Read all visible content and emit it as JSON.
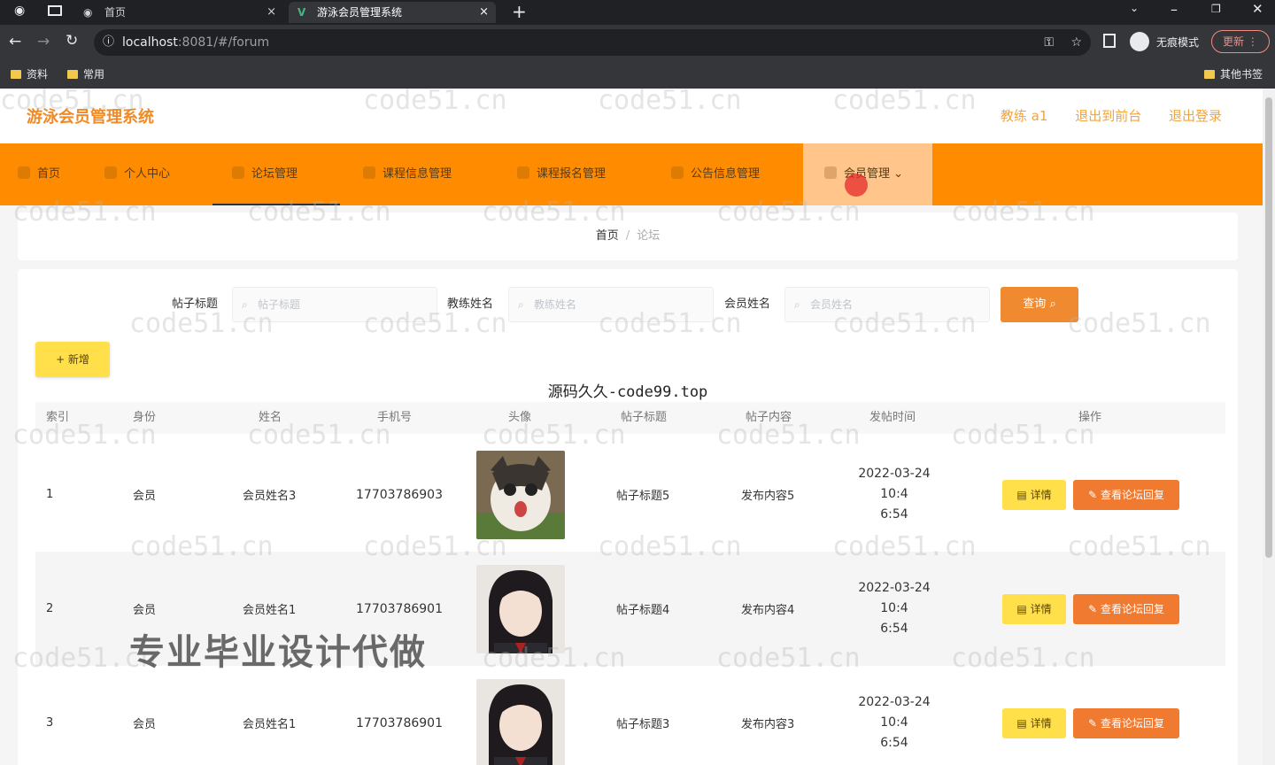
{
  "browser": {
    "tabs": [
      {
        "title": "首页",
        "close": "×"
      },
      {
        "title": "游泳会员管理系统",
        "close": "×"
      }
    ],
    "new_tab": "+",
    "url_host": "localhost",
    "url_rest": ":8081/#/forum",
    "profile": "无痕模式",
    "update": "更新",
    "bookmarks": [
      "资料",
      "常用"
    ],
    "other_bookmarks": "其他书签"
  },
  "header": {
    "brand": "游泳会员管理系统",
    "user": "教练 a1",
    "back_front": "退出到前台",
    "logout": "退出登录"
  },
  "nav": {
    "items": [
      "首页",
      "个人中心",
      "论坛管理",
      "课程信息管理",
      "课程报名管理",
      "公告信息管理",
      "会员管理"
    ]
  },
  "breadcrumb": {
    "home": "首页",
    "sep": "/",
    "current": "论坛"
  },
  "search": {
    "fields": [
      {
        "label": "帖子标题",
        "placeholder": "帖子标题"
      },
      {
        "label": "教练姓名",
        "placeholder": "教练姓名"
      },
      {
        "label": "会员姓名",
        "placeholder": "会员姓名"
      }
    ],
    "query_button": "查询",
    "add_button": "+ 新增"
  },
  "overlay_text": "源码久久-code99.top",
  "watermark": "code51.cn",
  "ad_text": "专业毕业设计代做",
  "table": {
    "headers": [
      "索引",
      "身份",
      "姓名",
      "手机号",
      "头像",
      "帖子标题",
      "帖子内容",
      "发帖时间",
      "操作"
    ],
    "rows": [
      {
        "index": "1",
        "role": "会员",
        "name": "会员姓名3",
        "phone": "17703786903",
        "avatar": "cat-photo",
        "title": "帖子标题5",
        "content": "发布内容5",
        "time1": "2022-03-24 10:4",
        "time2": "6:54"
      },
      {
        "index": "2",
        "role": "会员",
        "name": "会员姓名1",
        "phone": "17703786901",
        "avatar": "girl-photo",
        "title": "帖子标题4",
        "content": "发布内容4",
        "time1": "2022-03-24 10:4",
        "time2": "6:54"
      },
      {
        "index": "3",
        "role": "会员",
        "name": "会员姓名1",
        "phone": "17703786901",
        "avatar": "girl-photo",
        "title": "帖子标题3",
        "content": "发布内容3",
        "time1": "2022-03-24 10:4",
        "time2": "6:54"
      }
    ],
    "detail_button": "详情",
    "reply_button": "查看论坛回复"
  },
  "colors": {
    "nav_bg": "#ff8c00",
    "brand": "#f08a24",
    "query_btn": "#f08a30",
    "add_btn": "#ffe04a"
  }
}
